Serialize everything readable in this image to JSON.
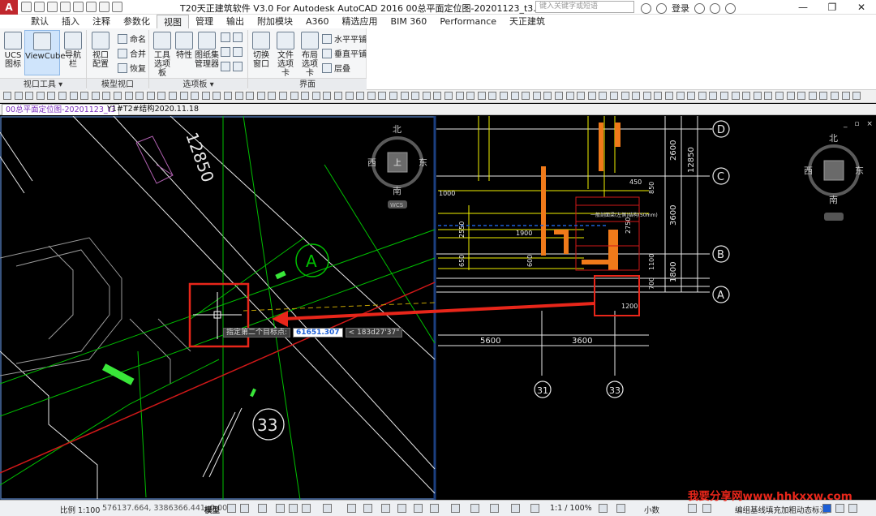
{
  "titlebar": {
    "title": "T20天正建筑软件 V3.0 For Autodesk AutoCAD 2016     00总平面定位图-20201123_t3.dwg",
    "search_placeholder": "键入关键字或短语",
    "login_label": "登录",
    "logo": "A"
  },
  "ribbon_tabs": [
    "默认",
    "插入",
    "注释",
    "参数化",
    "视图",
    "管理",
    "输出",
    "附加模块",
    "A360",
    "精选应用",
    "BIM 360",
    "Performance",
    "天正建筑"
  ],
  "active_tab": "视图",
  "ribbon": {
    "ucs_label": "UCS\n图标",
    "viewcube_label": "ViewCube",
    "navbar_label": "导航栏",
    "viewport_config_label": "视口\n配置",
    "named_label": "命名",
    "join_label": "合并",
    "restore_label": "恢复",
    "tool_palette_label": "工具\n选项板",
    "properties_label": "特性",
    "sheet_set_label": "图纸集\n管理器",
    "switch_window_label": "切换\n窗口",
    "file_tabs_label": "文件\n选项卡",
    "layout_tabs_label": "布局\n选项卡",
    "tile_h_label": "水平平铺",
    "tile_v_label": "垂直平铺",
    "cascade_label": "层叠",
    "panel_viewport_tools": "视口工具",
    "panel_model_viewports": "模型视口",
    "panel_palettes": "选项板",
    "panel_interface": "界面"
  },
  "file_tabs": [
    "00总平面定位图-20201123_t3",
    "Y1#T2#结构2020.11.18"
  ],
  "active_file_tab": "00总平面定位图-20201123_t3",
  "command": {
    "prompt": "指定第二个目标点:",
    "input_value": "61651.307",
    "angle_value": "< 183d27'37\""
  },
  "drawing": {
    "compass": {
      "north": "北",
      "south": "南",
      "east": "东",
      "west": "西",
      "top": "上",
      "wcs": "WCS"
    },
    "dim_12850_rot": "12850",
    "axis_a": "A",
    "axis_33": "33",
    "axis_labels_right": [
      "D",
      "C",
      "B",
      "A"
    ],
    "axis_labels_bottom": [
      "31",
      "33"
    ],
    "dims_right": [
      "2600",
      "3600",
      "1800",
      "12850"
    ],
    "dims_bottom": [
      "5600",
      "3600"
    ],
    "dims_small": [
      "2550",
      "1900",
      "2750",
      "1100",
      "700",
      "1200",
      "1000",
      "850",
      "450",
      "650",
      "600"
    ],
    "notes": [
      "一般剖面梁(左侧)结构(50mm)"
    ],
    "viewport_controls": "_ ▫ ×"
  },
  "statusbar": {
    "scale_label": "比例 1:100",
    "coords": "576137.664, 3386366.441, 0.000",
    "model_label": "模型",
    "zoom_label": "1:1 / 100%",
    "decimal_label": "小数",
    "right_text": "编组基线填充加粗动态标注"
  },
  "watermark": "我要分享网www.hhkxxw.com",
  "colors": {
    "accent_red": "#e8261a",
    "cad_green": "#00c000",
    "cad_yellow": "#f2f200",
    "cad_orange": "#f07a1a",
    "highlight_blue": "#1d5fd6"
  }
}
